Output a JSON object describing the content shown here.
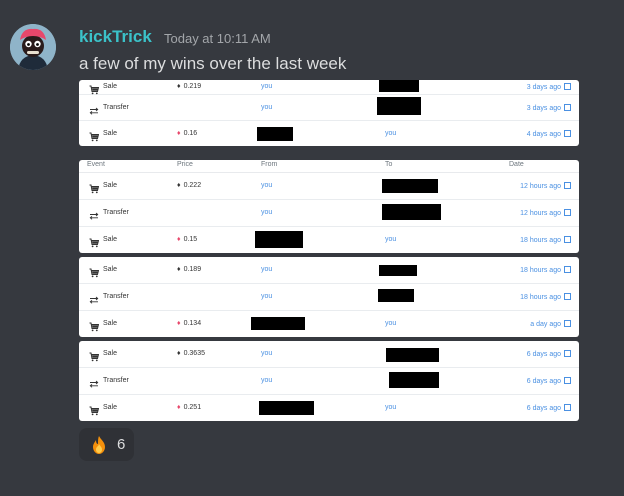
{
  "message": {
    "username": "kickTrick",
    "timestamp": "Today at 10:11 AM",
    "text": "a few of my wins over the last week",
    "avatar_icon": "avatar-icon"
  },
  "table_headers": {
    "event": "Event",
    "price": "Price",
    "from": "From",
    "to": "To",
    "date": "Date"
  },
  "cards": [
    {
      "rows": [
        {
          "event": "Sale",
          "icon": "cart-icon",
          "price": "0.219",
          "eth_color": "dark",
          "from": "you",
          "to": "",
          "date": "3 days ago"
        },
        {
          "event": "Transfer",
          "icon": "transfer-icon",
          "price": "",
          "eth_color": "",
          "from": "you",
          "to": "",
          "date": "3 days ago"
        },
        {
          "event": "Sale",
          "icon": "cart-icon",
          "price": "0.16",
          "eth_color": "red",
          "from": "",
          "to": "you",
          "date": "4 days ago"
        }
      ]
    },
    {
      "rows": [
        {
          "event": "Sale",
          "icon": "cart-icon",
          "price": "0.222",
          "eth_color": "dark",
          "from": "you",
          "to": "",
          "date": "12 hours ago"
        },
        {
          "event": "Transfer",
          "icon": "transfer-icon",
          "price": "",
          "eth_color": "",
          "from": "you",
          "to": "",
          "date": "12 hours ago"
        },
        {
          "event": "Sale",
          "icon": "cart-icon",
          "price": "0.15",
          "eth_color": "red",
          "from": "",
          "to": "you",
          "date": "18 hours ago"
        }
      ]
    },
    {
      "rows": [
        {
          "event": "Sale",
          "icon": "cart-icon",
          "price": "0.189",
          "eth_color": "dark",
          "from": "you",
          "to": "",
          "date": "18 hours ago"
        },
        {
          "event": "Transfer",
          "icon": "transfer-icon",
          "price": "",
          "eth_color": "",
          "from": "you",
          "to": "",
          "date": "18 hours ago"
        },
        {
          "event": "Sale",
          "icon": "cart-icon",
          "price": "0.134",
          "eth_color": "red",
          "from": "",
          "to": "you",
          "date": "a day ago"
        }
      ]
    },
    {
      "rows": [
        {
          "event": "Sale",
          "icon": "cart-icon",
          "price": "0.3635",
          "eth_color": "dark",
          "from": "you",
          "to": "",
          "date": "6 days ago"
        },
        {
          "event": "Transfer",
          "icon": "transfer-icon",
          "price": "",
          "eth_color": "",
          "from": "you",
          "to": "",
          "date": "6 days ago"
        },
        {
          "event": "Sale",
          "icon": "cart-icon",
          "price": "0.251",
          "eth_color": "red",
          "from": "",
          "to": "you",
          "date": "6 days ago"
        }
      ]
    }
  ],
  "reaction": {
    "emoji_icon": "fire-icon",
    "count": "6"
  },
  "colors": {
    "background": "#36393f",
    "username": "#3bc2c9",
    "link": "#4a90e2",
    "eth_red": "#e8476b"
  }
}
